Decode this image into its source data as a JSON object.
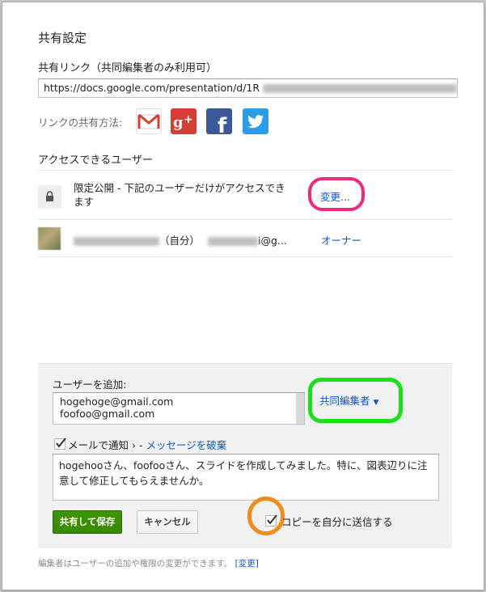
{
  "dialog": {
    "title": "共有設定",
    "link_label": "共有リンク（共同編集者のみ利用可）",
    "link_url": "https://docs.google.com/presentation/d/1R",
    "share_via_label": "リンクの共有方法:",
    "share_icons": [
      "gmail-icon",
      "google-plus-icon",
      "facebook-icon",
      "twitter-icon"
    ],
    "access_label": "アクセスできるユーザー",
    "visibility": {
      "text": "限定公開 - 下記のユーザーだけがアクセスできます",
      "change_link": "変更..."
    },
    "owner": {
      "name_suffix": "（自分）",
      "email_suffix": "i@g...",
      "role": "オーナー"
    },
    "add_people": {
      "label": "ユーザーを追加:",
      "users": [
        "hogehoge@gmail.com",
        "foofoo@gmail.com"
      ],
      "role_label": "共同編集者"
    },
    "notify": {
      "checked": true,
      "label": "メールで通知",
      "separator": " › - ",
      "discard_link": "メッセージを破棄"
    },
    "message": "hogehooさん、foofooさん、スライドを作成してみました。特に、図表辺りに注意して修正してもらえませんか。",
    "buttons": {
      "save": "共有して保存",
      "cancel": "キャンセル"
    },
    "send_copy": {
      "checked": true,
      "label": "コピーを自分に送信する"
    },
    "footer": {
      "text": "編集者はユーザーの追加や権限の変更ができます。",
      "link": "[変更]"
    },
    "annotation_colors": {
      "change_ring": "#ee2a7b",
      "role_ring": "#19e019",
      "copy_ring": "#f08c1c"
    }
  }
}
